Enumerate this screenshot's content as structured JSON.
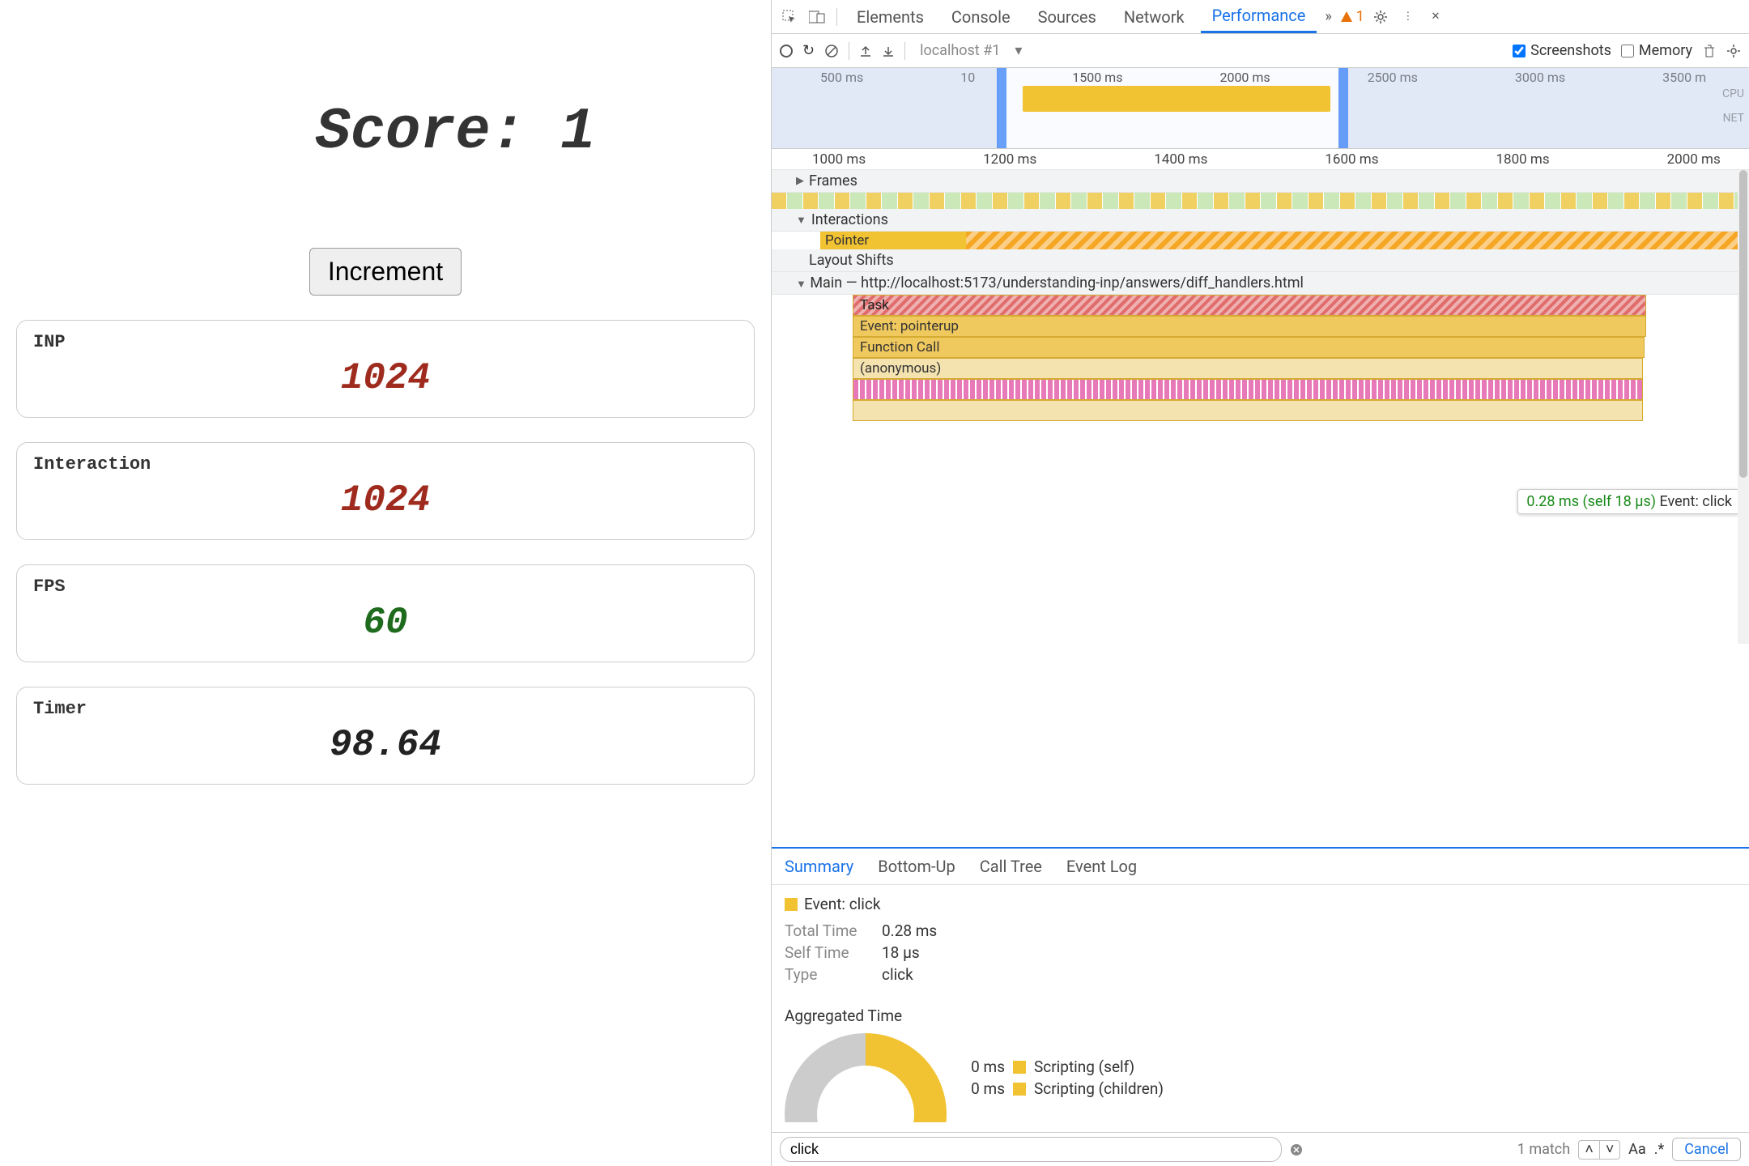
{
  "app": {
    "score_label": "Score: ",
    "score_value": "1",
    "increment_label": "Increment",
    "metrics": [
      {
        "label": "INP",
        "value": "1024",
        "tone": "red"
      },
      {
        "label": "Interaction",
        "value": "1024",
        "tone": "red"
      },
      {
        "label": "FPS",
        "value": "60",
        "tone": "green"
      },
      {
        "label": "Timer",
        "value": "98.64",
        "tone": "black"
      }
    ]
  },
  "devtools": {
    "tabs": [
      "Elements",
      "Console",
      "Sources",
      "Network",
      "Performance"
    ],
    "active_tab": "Performance",
    "warning_count": "1",
    "toolbar": {
      "origin_label": "localhost #1",
      "screenshots_label": "Screenshots",
      "screenshots_checked": true,
      "memory_label": "Memory",
      "memory_checked": false
    },
    "overview": {
      "ticks": [
        "500 ms",
        "10",
        "ms",
        "1500 ms",
        "2000 ms",
        "2500 ms",
        "3000 ms",
        "3500 m"
      ],
      "lane_labels": [
        "CPU",
        "NET"
      ]
    },
    "detail_ruler": [
      "1000 ms",
      "1200 ms",
      "1400 ms",
      "1600 ms",
      "1800 ms",
      "2000 ms"
    ],
    "tracks": {
      "frames_label": "Frames",
      "interactions_label": "Interactions",
      "pointer_label": "Pointer",
      "layout_shifts_label": "Layout Shifts",
      "main_label": "Main — http://localhost:5173/understanding-inp/answers/diff_handlers.html",
      "flame": [
        "Task",
        "Event: pointerup",
        "Function Call",
        "(anonymous)"
      ]
    },
    "tooltip": {
      "timing": "0.28 ms (self 18 µs)",
      "name": "Event: click"
    },
    "bottom_tabs": [
      "Summary",
      "Bottom-Up",
      "Call Tree",
      "Event Log"
    ],
    "summary": {
      "event_title": "Event: click",
      "rows": [
        {
          "k": "Total Time",
          "v": "0.28 ms"
        },
        {
          "k": "Self Time",
          "v": "18 µs"
        },
        {
          "k": "Type",
          "v": "click"
        }
      ],
      "aggregated_label": "Aggregated Time",
      "legend": [
        {
          "ms": "0 ms",
          "label": "Scripting (self)"
        },
        {
          "ms": "0 ms",
          "label": "Scripting (children)"
        }
      ]
    },
    "search": {
      "value": "click",
      "match_text": "1 match",
      "case_label": "Aa",
      "regex_label": ".*",
      "cancel_label": "Cancel"
    }
  }
}
